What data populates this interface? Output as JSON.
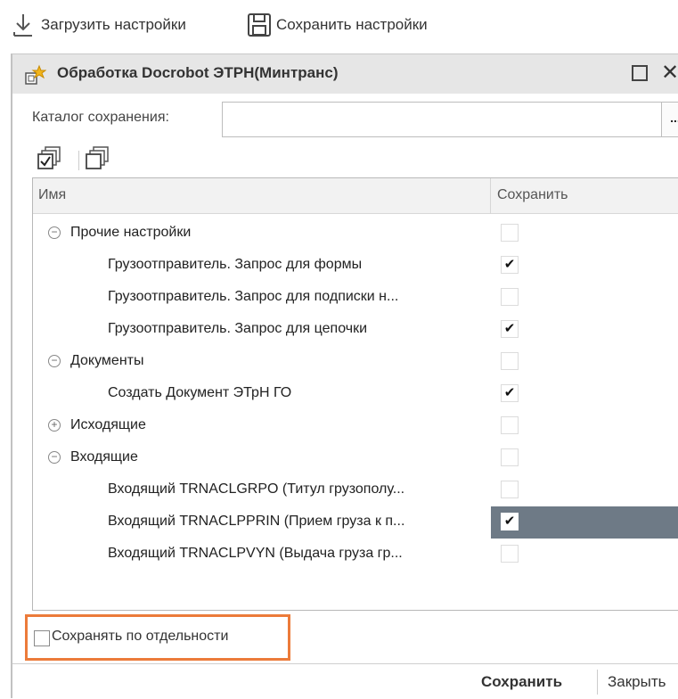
{
  "toolbar": {
    "load_label": "Загрузить настройки",
    "save_label": "Сохранить настройки"
  },
  "window": {
    "title": "Обработка  Docrobot ЭТРН(Минтранс)",
    "catalog_label": "Каталог сохранения:",
    "catalog_value": "",
    "catalog_button": "..."
  },
  "grid": {
    "col_name": "Имя",
    "col_save": "Сохранить",
    "rows": [
      {
        "label": "Прочие настройки",
        "level": 0,
        "toggle": "minus",
        "checked": false,
        "selected": false
      },
      {
        "label": "Грузоотправитель. Запрос для формы",
        "level": 1,
        "toggle": null,
        "checked": true,
        "selected": false
      },
      {
        "label": "Грузоотправитель. Запрос для подписки н...",
        "level": 1,
        "toggle": null,
        "checked": false,
        "selected": false
      },
      {
        "label": "Грузоотправитель. Запрос для цепочки",
        "level": 1,
        "toggle": null,
        "checked": true,
        "selected": false
      },
      {
        "label": "Документы",
        "level": 0,
        "toggle": "minus",
        "checked": false,
        "selected": false
      },
      {
        "label": "Создать Документ ЭТрН ГО",
        "level": 1,
        "toggle": null,
        "checked": true,
        "selected": false
      },
      {
        "label": "Исходящие",
        "level": 0,
        "toggle": "plus",
        "checked": false,
        "selected": false
      },
      {
        "label": "Входящие",
        "level": 0,
        "toggle": "minus",
        "checked": false,
        "selected": false
      },
      {
        "label": "Входящий TRNACLGRPO (Титул грузополу...",
        "level": 1,
        "toggle": null,
        "checked": false,
        "selected": false
      },
      {
        "label": "Входящий TRNACLPPRIN (Прием груза к п...",
        "level": 1,
        "toggle": null,
        "checked": true,
        "selected": true
      },
      {
        "label": "Входящий TRNACLPVYN (Выдача груза гр...",
        "level": 1,
        "toggle": null,
        "checked": false,
        "selected": false
      }
    ]
  },
  "options": {
    "save_separately_label": "Сохранять по отдельности",
    "save_separately_checked": false
  },
  "footer": {
    "save_button": "Сохранить",
    "close_button": "Закрыть"
  },
  "colors": {
    "highlight_border": "#ec7b3a",
    "selected_cell": "#6e7a86",
    "title_bar": "#e6e6e6"
  }
}
